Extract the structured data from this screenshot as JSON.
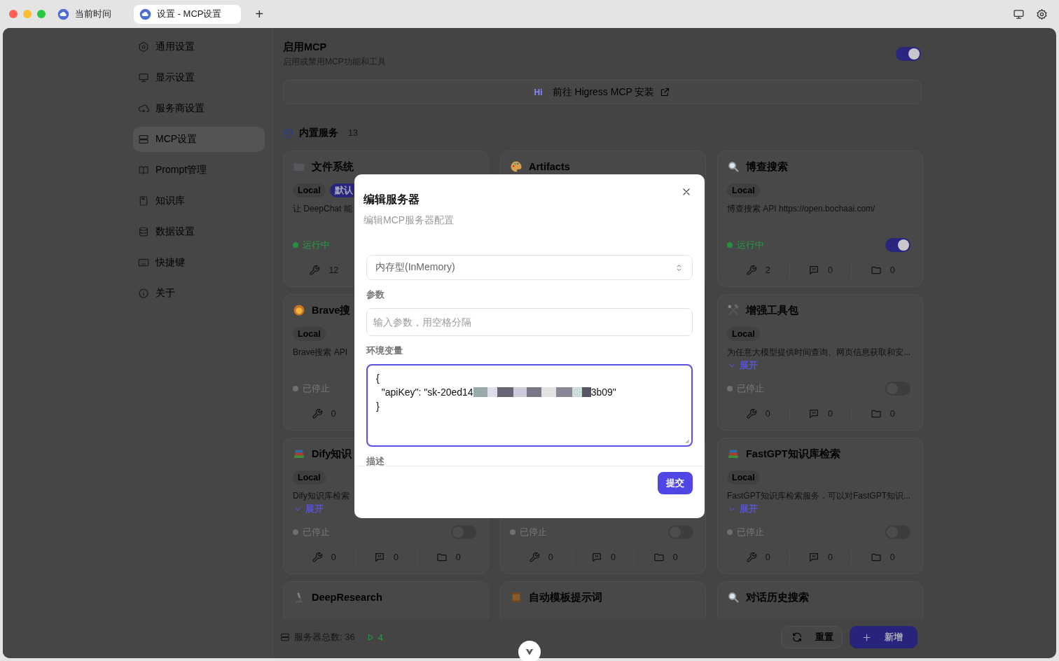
{
  "tabs": [
    {
      "title": "当前时间",
      "selected": false
    },
    {
      "title": "设置 - MCP设置",
      "selected": true
    }
  ],
  "new_tab": "+",
  "sidebar": {
    "items": [
      {
        "label": "通用设置",
        "selected": false
      },
      {
        "label": "显示设置",
        "selected": false
      },
      {
        "label": "服务商设置",
        "selected": false
      },
      {
        "label": "MCP设置",
        "selected": true
      },
      {
        "label": "Prompt管理",
        "selected": false
      },
      {
        "label": "知识库",
        "selected": false
      },
      {
        "label": "数据设置",
        "selected": false
      },
      {
        "label": "快捷键",
        "selected": false
      },
      {
        "label": "关于",
        "selected": false
      }
    ]
  },
  "mcp": {
    "title": "启用MCP",
    "subtitle": "启用或禁用MCP功能和工具",
    "enabled": true,
    "install_button": {
      "logo": "Hi",
      "label": "前往 Higress MCP 安装"
    },
    "section": {
      "title": "内置服务",
      "count": "13"
    },
    "columns": [
      [
        {
          "name": "文件系统",
          "tags": [
            {
              "label": "Local",
              "kind": "plain"
            },
            {
              "label": "默认",
              "kind": "default"
            }
          ],
          "description": "让 DeepChat 能",
          "status": {
            "label": "运行中",
            "running": true
          },
          "stats": [
            {
              "kind": "tools",
              "count": "12"
            }
          ]
        },
        {
          "name": "Brave搜",
          "tags": [
            {
              "label": "Local",
              "kind": "plain"
            }
          ],
          "description": "Brave搜索 API",
          "status": {
            "label": "已停止",
            "running": false
          },
          "stats": [
            {
              "kind": "tools",
              "count": "0"
            }
          ]
        },
        {
          "name": "Dify知识",
          "tags": [
            {
              "label": "Local",
              "kind": "plain"
            }
          ],
          "description": "Dify知识库检索",
          "expand": "展开",
          "status": {
            "label": "已停止",
            "running": false
          },
          "enabled": false,
          "stats": [
            {
              "kind": "tools",
              "count": "0"
            },
            {
              "kind": "prompts",
              "count": "0"
            },
            {
              "kind": "resources",
              "count": "0"
            }
          ]
        },
        {
          "name": "DeepResearch"
        }
      ],
      [
        {
          "name": "Artifacts"
        },
        {},
        {
          "status": {
            "label": "已停止",
            "running": false
          },
          "enabled": false,
          "stats": [
            {
              "kind": "tools",
              "count": "0"
            },
            {
              "kind": "prompts",
              "count": "0"
            },
            {
              "kind": "resources",
              "count": "0"
            }
          ]
        },
        {
          "name": "自动模板提示词"
        }
      ],
      [
        {
          "name": "博查搜索",
          "tags": [
            {
              "label": "Local",
              "kind": "plain"
            }
          ],
          "description": "博查搜索 API https://open.bochaai.com/",
          "status": {
            "label": "运行中",
            "running": true
          },
          "enabled": true,
          "stats": [
            {
              "kind": "tools",
              "count": "2"
            },
            {
              "kind": "prompts",
              "count": "0"
            },
            {
              "kind": "resources",
              "count": "0"
            }
          ]
        },
        {
          "name": "增强工具包",
          "tags": [
            {
              "label": "Local",
              "kind": "plain"
            }
          ],
          "description": "为任意大模型提供时间查询、网页信息获取和安...",
          "expand": "展开",
          "status": {
            "label": "已停止",
            "running": false
          },
          "enabled": false,
          "stats": [
            {
              "kind": "tools",
              "count": "0"
            },
            {
              "kind": "prompts",
              "count": "0"
            },
            {
              "kind": "resources",
              "count": "0"
            }
          ]
        },
        {
          "name": "FastGPT知识库检索",
          "tags": [
            {
              "label": "Local",
              "kind": "plain"
            }
          ],
          "description": "FastGPT知识库检索服务，可以对FastGPT知识...",
          "expand": "展开",
          "status": {
            "label": "已停止",
            "running": false
          },
          "enabled": false,
          "stats": [
            {
              "kind": "tools",
              "count": "0"
            },
            {
              "kind": "prompts",
              "count": "0"
            },
            {
              "kind": "resources",
              "count": "0"
            }
          ]
        },
        {
          "name": "对话历史搜索"
        }
      ]
    ]
  },
  "footer": {
    "total": "服务器总数: 36",
    "running": "4",
    "reset": "重置",
    "add": "新增"
  },
  "dialog": {
    "title": "编辑服务器",
    "subtitle": "编辑MCP服务器配置",
    "fields": [
      {
        "kind": "select",
        "value": "内存型(InMemory)"
      },
      {
        "kind": "input",
        "label": "参数",
        "placeholder": "输入参数，用空格分隔"
      },
      {
        "kind": "code",
        "label": "环境变量",
        "focused": true,
        "value_before": "{\n  \"apiKey\": \"sk-20ed14",
        "redacted": true,
        "value_after": "3b09\"\n}"
      },
      {
        "kind": "label",
        "label": "描述"
      }
    ],
    "submit": "提交"
  }
}
